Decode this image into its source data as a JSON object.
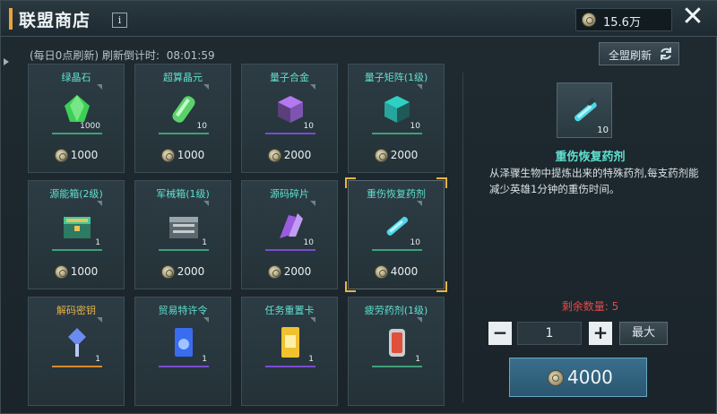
{
  "header": {
    "title": "联盟商店",
    "info_icon": "i",
    "currency_value": "15.6万",
    "close_label": "✕"
  },
  "refresh": {
    "note": "(每日0点刷新)",
    "countdown_label": "刷新倒计时:",
    "countdown_time": "08:01:59",
    "refresh_all_label": "全盟刷新"
  },
  "items": [
    {
      "name": "绿晶石",
      "qty": "1000",
      "price": "1000",
      "icon": "green-crystal-icon",
      "color": "#3ccf55",
      "rarity": "green"
    },
    {
      "name": "超算晶元",
      "qty": "10",
      "price": "1000",
      "icon": "green-capsule-icon",
      "color": "#5ad26a",
      "rarity": "green"
    },
    {
      "name": "量子合金",
      "qty": "10",
      "price": "2000",
      "icon": "purple-cube-icon",
      "color": "#b478f0",
      "rarity": "purple"
    },
    {
      "name": "量子矩阵(1级)",
      "qty": "10",
      "price": "2000",
      "icon": "teal-cube-icon",
      "color": "#2fd0c4",
      "rarity": "green"
    },
    {
      "name": "源能箱(2级)",
      "qty": "1",
      "price": "1000",
      "icon": "gold-chest-icon",
      "color": "#3ccb9a",
      "rarity": "green"
    },
    {
      "name": "军械箱(1级)",
      "qty": "1",
      "price": "2000",
      "icon": "gray-chest-icon",
      "color": "#9aa4aa",
      "rarity": "green"
    },
    {
      "name": "源码碎片",
      "qty": "10",
      "price": "2000",
      "icon": "purple-shard-icon",
      "color": "#9b5ce0",
      "rarity": "purple"
    },
    {
      "name": "重伤恢复药剂",
      "qty": "10",
      "price": "4000",
      "icon": "cyan-syringe-icon",
      "color": "#4ed6e6",
      "rarity": "green",
      "selected": true
    },
    {
      "name": "解码密钥",
      "qty": "1",
      "price": "",
      "icon": "blue-key-icon",
      "color": "#6a8cf0",
      "rarity": "orange",
      "name_color": "gold"
    },
    {
      "name": "贸易特许令",
      "qty": "1",
      "price": "",
      "icon": "blue-permit-icon",
      "color": "#3a6cf0",
      "rarity": "purple"
    },
    {
      "name": "任务重置卡",
      "qty": "1",
      "price": "",
      "icon": "yellow-card-icon",
      "color": "#f0c230",
      "rarity": "purple"
    },
    {
      "name": "疲劳药剂(1级)",
      "qty": "1",
      "price": "",
      "icon": "red-canister-icon",
      "color": "#e0503a",
      "rarity": "green"
    }
  ],
  "detail": {
    "qty": "10",
    "name": "重伤恢复药剂",
    "description": "从泽骤生物中提炼出来的特殊药剂,每支药剂能减少英雄1分钟的重伤时间。",
    "remaining_label": "剩余数量: 5",
    "quantity": "1",
    "minus_label": "−",
    "plus_label": "+",
    "max_label": "最大",
    "buy_price": "4000"
  }
}
